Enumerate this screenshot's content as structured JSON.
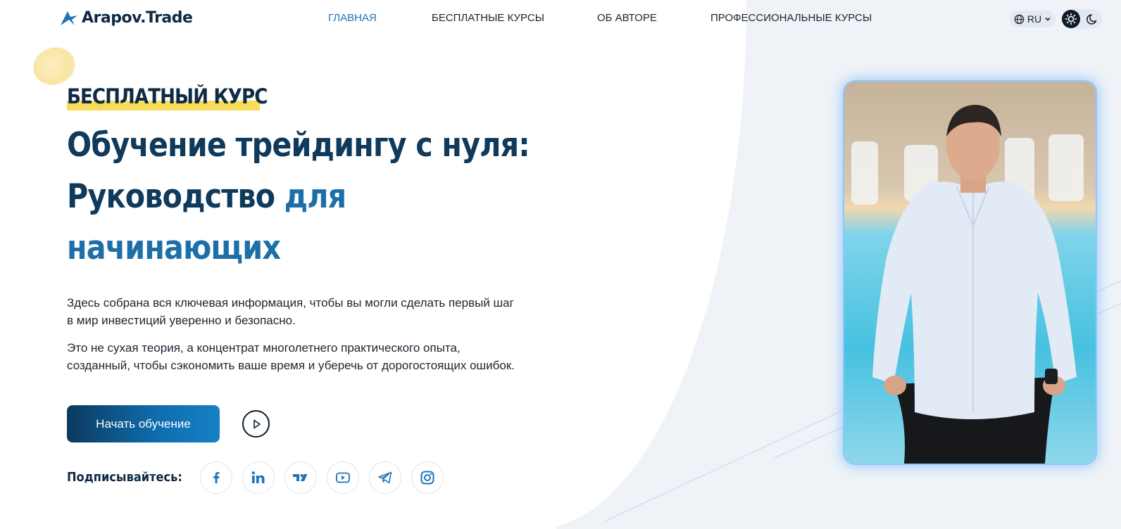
{
  "header": {
    "logo_text": "Arapov.Trade",
    "nav": [
      {
        "label": "ГЛАВНАЯ",
        "active": true
      },
      {
        "label": "БЕСПЛАТНЫЕ КУРСЫ",
        "active": false
      },
      {
        "label": "ОБ АВТОРЕ",
        "active": false
      },
      {
        "label": "ПРОФЕССИОНАЛЬНЫЕ КУРСЫ",
        "active": false
      }
    ],
    "language": "RU",
    "icons": [
      "globe-icon",
      "chevron-down-icon",
      "sun-icon",
      "moon-icon"
    ]
  },
  "hero": {
    "tag": "БЕСПЛАТНЫЙ КУРС",
    "title_line1": "Обучение трейдингу с нуля:",
    "title_line2_a": "Руководство",
    "title_line2_b": "для",
    "title_line3": "начинающих",
    "paragraph1": "Здесь собрана вся ключевая информация, чтобы вы могли сделать первый шаг в мир инвестиций уверенно и безопасно.",
    "paragraph2": "Это не сухая теория, а концентрат многолетнего практического опыта, созданный, чтобы сэкономить ваше время и уберечь от дорогостоящих ошибок.",
    "cta_label": "Начать обучение",
    "subscribe_label": "Подписывайтесь:",
    "social": [
      "facebook-icon",
      "linkedin-icon",
      "tradingview-icon",
      "youtube-icon",
      "telegram-icon",
      "instagram-icon"
    ]
  },
  "colors": {
    "accent": "#1f74b7",
    "dark": "#0f2a44",
    "highlight": "#f6dc5a",
    "button_start": "#0c3a5e",
    "button_end": "#1680c4"
  }
}
